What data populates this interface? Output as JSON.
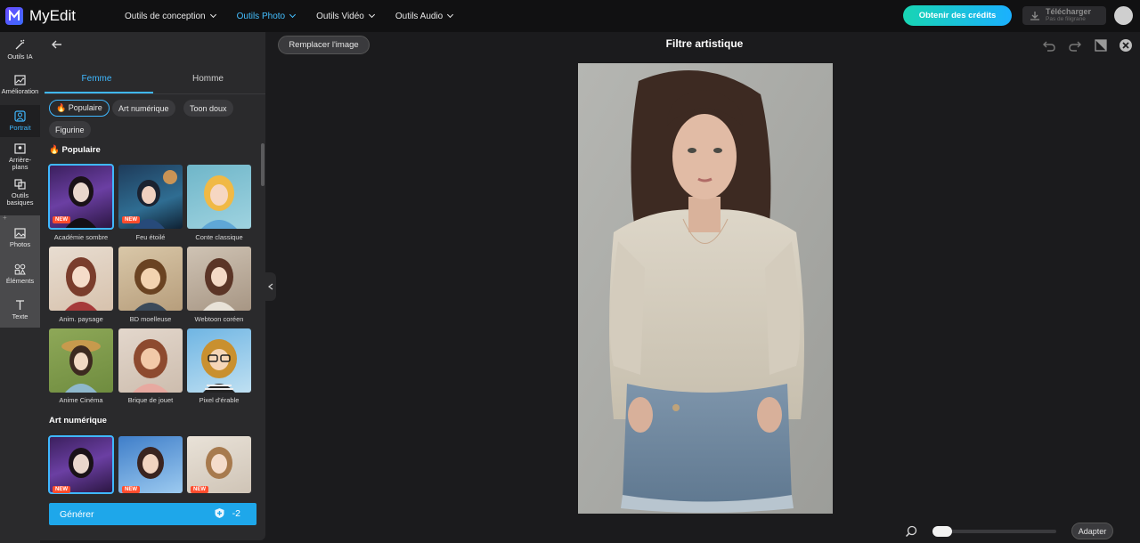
{
  "app": {
    "name": "MyEdit"
  },
  "topnav": [
    {
      "label": "Outils de conception",
      "active": false
    },
    {
      "label": "Outils Photo",
      "active": true
    },
    {
      "label": "Outils Vidéo",
      "active": false
    },
    {
      "label": "Outils Audio",
      "active": false
    }
  ],
  "header": {
    "credits_label": "Obtenir des crédits",
    "download_label": "Télécharger",
    "download_sub": "Pas de filigrane"
  },
  "rail": [
    {
      "label": "Outils IA",
      "icon": "magic-wand-icon"
    },
    {
      "label": "Amélioration",
      "icon": "enhance-icon"
    },
    {
      "label": "Portrait",
      "icon": "portrait-icon",
      "active": true
    },
    {
      "label": "Arrière-plans",
      "icon": "background-icon"
    },
    {
      "label": "Outils basiques",
      "icon": "basic-tools-icon"
    },
    {
      "label": "Photos",
      "icon": "photos-icon"
    },
    {
      "label": "Éléments",
      "icon": "elements-icon"
    },
    {
      "label": "Texte",
      "icon": "text-icon"
    }
  ],
  "panel": {
    "tabs": [
      {
        "label": "Femme",
        "active": true
      },
      {
        "label": "Homme",
        "active": false
      }
    ],
    "chips": [
      {
        "label": "🔥 Populaire",
        "active": true
      },
      {
        "label": "Art numérique"
      },
      {
        "label": "Toon doux"
      },
      {
        "label": "Figurine"
      }
    ],
    "sections": [
      {
        "title": "🔥 Populaire",
        "items": [
          {
            "label": "Académie sombre",
            "new": true,
            "selected": true
          },
          {
            "label": "Feu étoilé",
            "new": true
          },
          {
            "label": "Conte classique"
          },
          {
            "label": "Anim. paysage"
          },
          {
            "label": "BD moelleuse"
          },
          {
            "label": "Webtoon coréen"
          },
          {
            "label": "Anime Cinéma"
          },
          {
            "label": "Brique de jouet"
          },
          {
            "label": "Pixel d'érable"
          }
        ]
      },
      {
        "title": "Art numérique",
        "items": [
          {
            "label": "",
            "new": true,
            "selected": true
          },
          {
            "label": "",
            "new": true
          },
          {
            "label": "",
            "new": true
          }
        ]
      }
    ],
    "new_badge": "NEW",
    "generate_label": "Générer",
    "generate_cost": "-2"
  },
  "canvas": {
    "replace_label": "Remplacer l'image",
    "title": "Filtre artistique",
    "fit_label": "Adapter",
    "zoom_level": 0
  },
  "colors": {
    "accent": "#1ea7ea",
    "active_text": "#3fb8ff",
    "new_badge": "#ff4d2e"
  }
}
